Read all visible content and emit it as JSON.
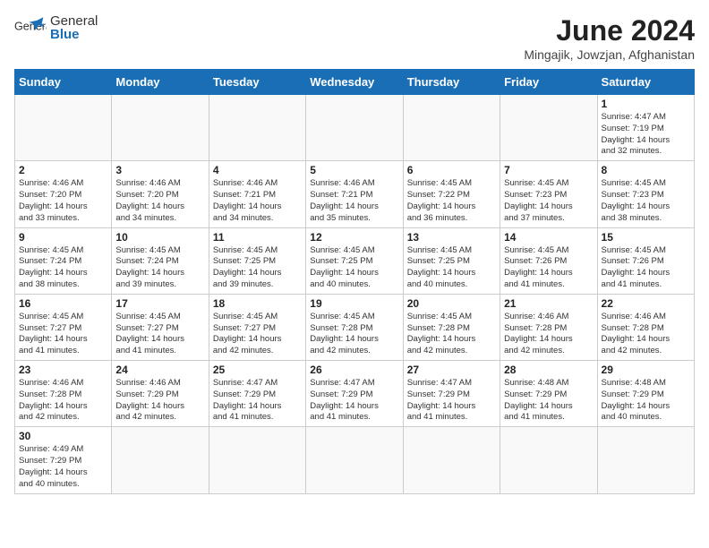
{
  "logo": {
    "text_general": "General",
    "text_blue": "Blue"
  },
  "title": "June 2024",
  "subtitle": "Mingajik, Jowzjan, Afghanistan",
  "days_of_week": [
    "Sunday",
    "Monday",
    "Tuesday",
    "Wednesday",
    "Thursday",
    "Friday",
    "Saturday"
  ],
  "weeks": [
    [
      {
        "day": "",
        "info": ""
      },
      {
        "day": "",
        "info": ""
      },
      {
        "day": "",
        "info": ""
      },
      {
        "day": "",
        "info": ""
      },
      {
        "day": "",
        "info": ""
      },
      {
        "day": "",
        "info": ""
      },
      {
        "day": "1",
        "info": "Sunrise: 4:47 AM\nSunset: 7:19 PM\nDaylight: 14 hours\nand 32 minutes."
      }
    ],
    [
      {
        "day": "2",
        "info": "Sunrise: 4:46 AM\nSunset: 7:20 PM\nDaylight: 14 hours\nand 33 minutes."
      },
      {
        "day": "3",
        "info": "Sunrise: 4:46 AM\nSunset: 7:20 PM\nDaylight: 14 hours\nand 34 minutes."
      },
      {
        "day": "4",
        "info": "Sunrise: 4:46 AM\nSunset: 7:21 PM\nDaylight: 14 hours\nand 34 minutes."
      },
      {
        "day": "5",
        "info": "Sunrise: 4:46 AM\nSunset: 7:21 PM\nDaylight: 14 hours\nand 35 minutes."
      },
      {
        "day": "6",
        "info": "Sunrise: 4:45 AM\nSunset: 7:22 PM\nDaylight: 14 hours\nand 36 minutes."
      },
      {
        "day": "7",
        "info": "Sunrise: 4:45 AM\nSunset: 7:23 PM\nDaylight: 14 hours\nand 37 minutes."
      },
      {
        "day": "8",
        "info": "Sunrise: 4:45 AM\nSunset: 7:23 PM\nDaylight: 14 hours\nand 38 minutes."
      }
    ],
    [
      {
        "day": "9",
        "info": "Sunrise: 4:45 AM\nSunset: 7:24 PM\nDaylight: 14 hours\nand 38 minutes."
      },
      {
        "day": "10",
        "info": "Sunrise: 4:45 AM\nSunset: 7:24 PM\nDaylight: 14 hours\nand 39 minutes."
      },
      {
        "day": "11",
        "info": "Sunrise: 4:45 AM\nSunset: 7:25 PM\nDaylight: 14 hours\nand 39 minutes."
      },
      {
        "day": "12",
        "info": "Sunrise: 4:45 AM\nSunset: 7:25 PM\nDaylight: 14 hours\nand 40 minutes."
      },
      {
        "day": "13",
        "info": "Sunrise: 4:45 AM\nSunset: 7:25 PM\nDaylight: 14 hours\nand 40 minutes."
      },
      {
        "day": "14",
        "info": "Sunrise: 4:45 AM\nSunset: 7:26 PM\nDaylight: 14 hours\nand 41 minutes."
      },
      {
        "day": "15",
        "info": "Sunrise: 4:45 AM\nSunset: 7:26 PM\nDaylight: 14 hours\nand 41 minutes."
      }
    ],
    [
      {
        "day": "16",
        "info": "Sunrise: 4:45 AM\nSunset: 7:27 PM\nDaylight: 14 hours\nand 41 minutes."
      },
      {
        "day": "17",
        "info": "Sunrise: 4:45 AM\nSunset: 7:27 PM\nDaylight: 14 hours\nand 41 minutes."
      },
      {
        "day": "18",
        "info": "Sunrise: 4:45 AM\nSunset: 7:27 PM\nDaylight: 14 hours\nand 42 minutes."
      },
      {
        "day": "19",
        "info": "Sunrise: 4:45 AM\nSunset: 7:28 PM\nDaylight: 14 hours\nand 42 minutes."
      },
      {
        "day": "20",
        "info": "Sunrise: 4:45 AM\nSunset: 7:28 PM\nDaylight: 14 hours\nand 42 minutes."
      },
      {
        "day": "21",
        "info": "Sunrise: 4:46 AM\nSunset: 7:28 PM\nDaylight: 14 hours\nand 42 minutes."
      },
      {
        "day": "22",
        "info": "Sunrise: 4:46 AM\nSunset: 7:28 PM\nDaylight: 14 hours\nand 42 minutes."
      }
    ],
    [
      {
        "day": "23",
        "info": "Sunrise: 4:46 AM\nSunset: 7:28 PM\nDaylight: 14 hours\nand 42 minutes."
      },
      {
        "day": "24",
        "info": "Sunrise: 4:46 AM\nSunset: 7:29 PM\nDaylight: 14 hours\nand 42 minutes."
      },
      {
        "day": "25",
        "info": "Sunrise: 4:47 AM\nSunset: 7:29 PM\nDaylight: 14 hours\nand 41 minutes."
      },
      {
        "day": "26",
        "info": "Sunrise: 4:47 AM\nSunset: 7:29 PM\nDaylight: 14 hours\nand 41 minutes."
      },
      {
        "day": "27",
        "info": "Sunrise: 4:47 AM\nSunset: 7:29 PM\nDaylight: 14 hours\nand 41 minutes."
      },
      {
        "day": "28",
        "info": "Sunrise: 4:48 AM\nSunset: 7:29 PM\nDaylight: 14 hours\nand 41 minutes."
      },
      {
        "day": "29",
        "info": "Sunrise: 4:48 AM\nSunset: 7:29 PM\nDaylight: 14 hours\nand 40 minutes."
      }
    ],
    [
      {
        "day": "30",
        "info": "Sunrise: 4:49 AM\nSunset: 7:29 PM\nDaylight: 14 hours\nand 40 minutes."
      },
      {
        "day": "",
        "info": ""
      },
      {
        "day": "",
        "info": ""
      },
      {
        "day": "",
        "info": ""
      },
      {
        "day": "",
        "info": ""
      },
      {
        "day": "",
        "info": ""
      },
      {
        "day": "",
        "info": ""
      }
    ]
  ]
}
